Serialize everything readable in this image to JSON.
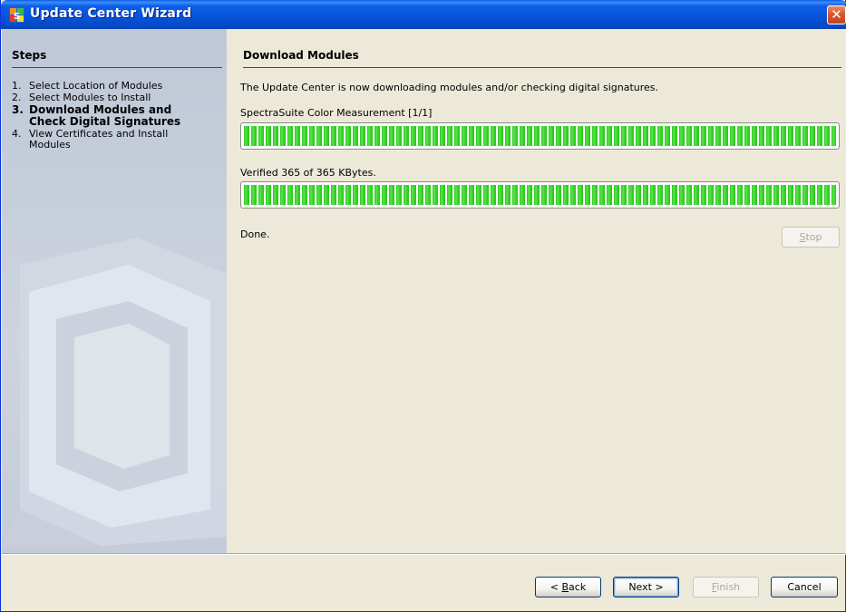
{
  "window": {
    "title": "Update Center Wizard",
    "app_icon": "spectrasuite-icon",
    "close_icon": "close-icon",
    "accent_color": "#0653d9"
  },
  "sidebar": {
    "title": "Steps",
    "steps": [
      {
        "number": "1.",
        "label": "Select Location of Modules",
        "current": false
      },
      {
        "number": "2.",
        "label": "Select Modules to Install",
        "current": false
      },
      {
        "number": "3.",
        "label": "Download Modules and Check Digital Signatures",
        "current": true
      },
      {
        "number": "4.",
        "label": "View Certificates and Install Modules",
        "current": false
      }
    ]
  },
  "main": {
    "title": "Download Modules",
    "description": "The Update Center is now downloading modules and/or checking digital signatures.",
    "module_label": "SpectraSuite Color Measurement [1/1]",
    "module_progress": 1.0,
    "verified_label": "Verified 365 of 365 KBytes.",
    "verify_progress": 1.0,
    "progress_color": "#2cc41f",
    "status": "Done.",
    "stop_button": {
      "mnemonic": "S",
      "rest": "top"
    }
  },
  "footer": {
    "back": {
      "prefix": "< ",
      "mnemonic": "B",
      "rest": "ack"
    },
    "next": "Next >",
    "finish": {
      "mnemonic": "F",
      "rest": "inish"
    },
    "cancel": "Cancel"
  }
}
